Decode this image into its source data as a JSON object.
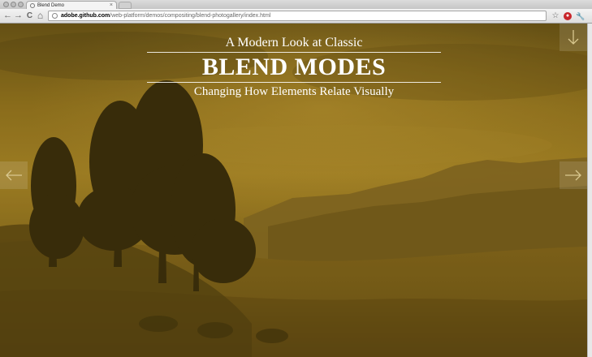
{
  "browser": {
    "tab_title": "Blend Demo",
    "tab_close": "×",
    "url_host": "adobe.github.com",
    "url_path": "/web-platform/demos/compositing/blend-photogallery/index.html",
    "icons": {
      "back": "←",
      "forward": "→",
      "reload": "C",
      "home": "⌂",
      "bookmark": "☆",
      "wrench": "🔧"
    }
  },
  "page": {
    "kicker": "A Modern Look at Classic",
    "title": "BLEND MODES",
    "subtitle": "Changing How Elements Relate Visually",
    "tint_color": "#8a6c1a"
  },
  "controls": {
    "down_arrow": "down-arrow-icon",
    "prev_arrow": "left-arrow-icon",
    "next_arrow": "right-arrow-icon"
  }
}
